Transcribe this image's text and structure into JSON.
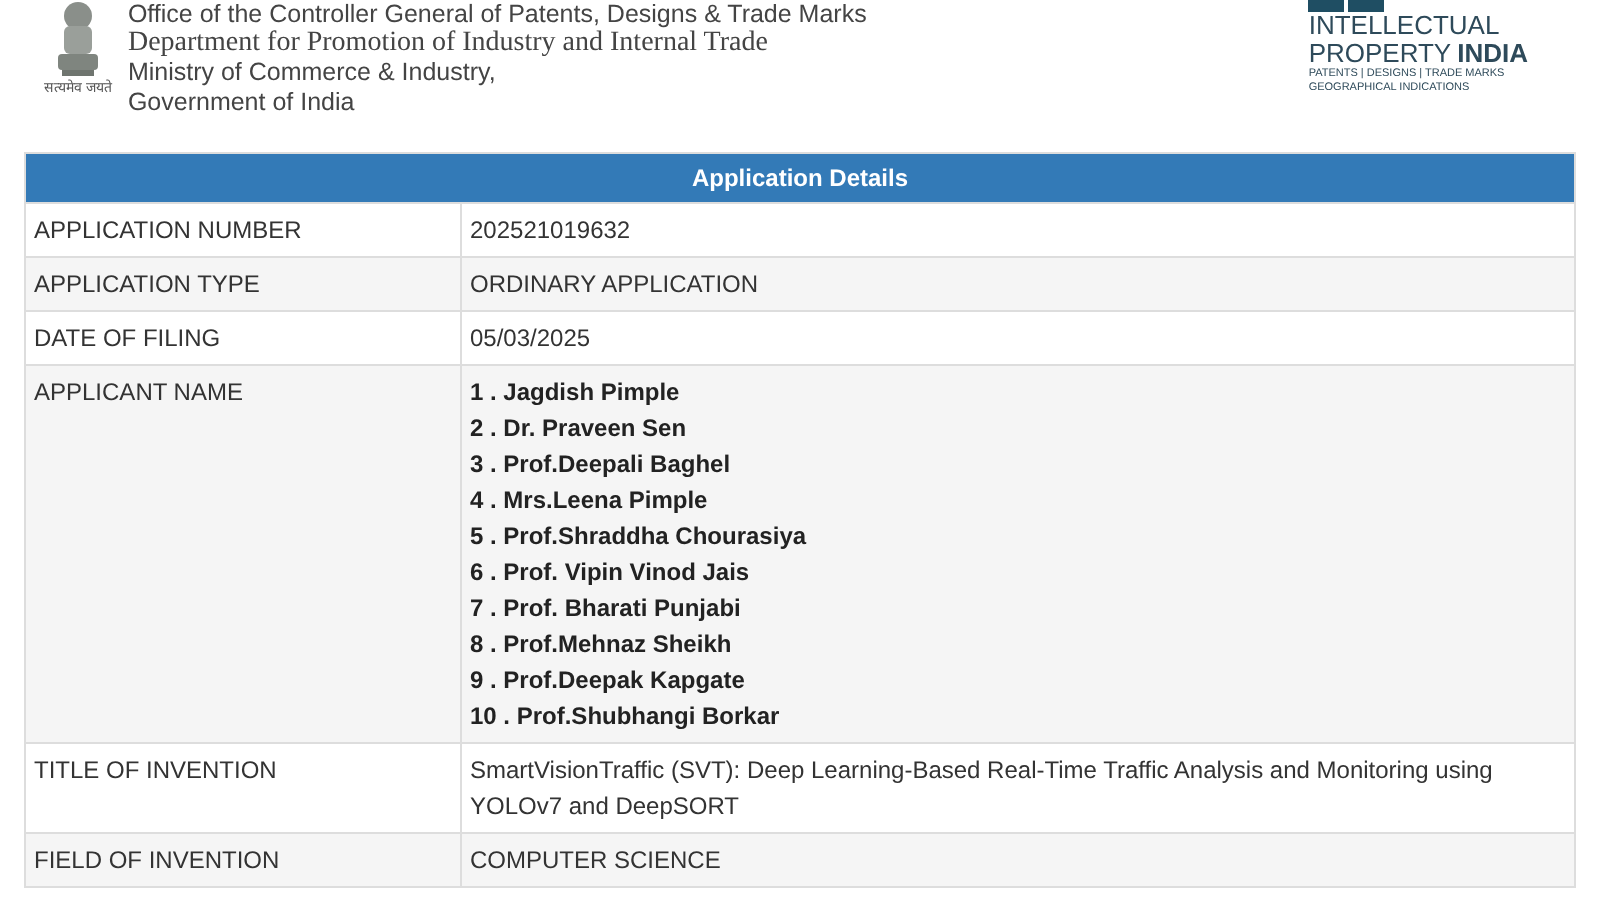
{
  "header": {
    "emblem_motto": "सत्यमेव जयते",
    "lines": [
      "Office of the Controller General of Patents, Designs & Trade Marks",
      "Department for Promotion of Industry and Internal Trade",
      "Ministry of Commerce & Industry,",
      "Government of India"
    ],
    "logo_lines": [
      "INTELLECTUAL",
      "PROPERTY",
      "INDIA",
      "PATENTS | DESIGNS | TRADE MARKS",
      "GEOGRAPHICAL INDICATIONS"
    ]
  },
  "table": {
    "title": "Application Details",
    "rows": [
      {
        "label": "APPLICATION NUMBER",
        "kind": "text",
        "value": "202521019632"
      },
      {
        "label": "APPLICATION TYPE",
        "kind": "text",
        "value": "ORDINARY APPLICATION"
      },
      {
        "label": "DATE OF FILING",
        "kind": "text",
        "value": "05/03/2025"
      },
      {
        "label": "APPLICANT NAME",
        "kind": "list",
        "items": [
          "1 . Jagdish Pimple",
          "2 . Dr. Praveen Sen",
          "3 . Prof.Deepali Baghel",
          "4 . Mrs.Leena Pimple",
          "5 . Prof.Shraddha Chourasiya",
          "6 . Prof. Vipin Vinod Jais",
          "7 . Prof. Bharati Punjabi",
          "8 . Prof.Mehnaz Sheikh",
          "9 . Prof.Deepak Kapgate",
          "10 . Prof.Shubhangi Borkar"
        ]
      },
      {
        "label": "TITLE OF INVENTION",
        "kind": "text",
        "value": "SmartVisionTraffic (SVT): Deep Learning-Based Real-Time Traffic Analysis and Monitoring using YOLOv7 and DeepSORT"
      },
      {
        "label": "FIELD OF INVENTION",
        "kind": "text",
        "value": "COMPUTER SCIENCE"
      }
    ]
  }
}
